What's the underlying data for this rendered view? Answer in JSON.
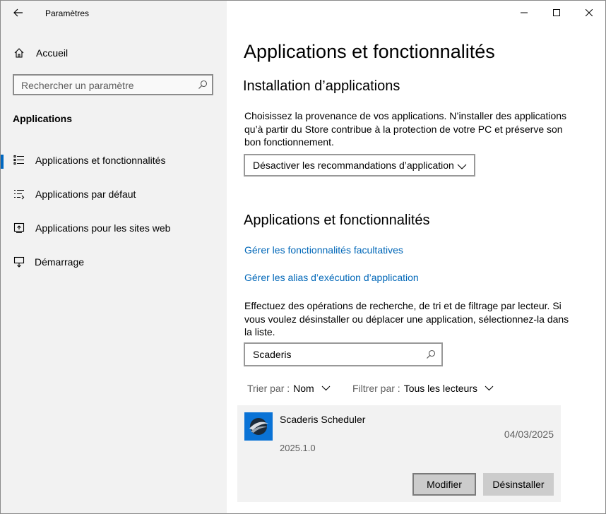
{
  "window": {
    "title": "Paramètres",
    "controls": [
      "minimize",
      "maximize",
      "close"
    ]
  },
  "sidebar": {
    "home_label": "Accueil",
    "search_placeholder": "Rechercher un paramètre",
    "section_title": "Applications",
    "items": [
      {
        "label": "Applications et fonctionnalités",
        "icon": "apps-features-icon",
        "selected": true
      },
      {
        "label": "Applications par défaut",
        "icon": "default-apps-icon",
        "selected": false
      },
      {
        "label": "Applications pour les sites web",
        "icon": "apps-for-websites-icon",
        "selected": false
      },
      {
        "label": "Démarrage",
        "icon": "startup-icon",
        "selected": false
      }
    ],
    "accent_color": "#0067c0"
  },
  "main": {
    "page_title": "Applications et fonctionnalités",
    "install_section": {
      "heading": "Installation d’applications",
      "description": "Choisissez la provenance de vos applications. N’installer des applications qu’à partir du Store contribue à la protection de votre PC et préserve son bon fonctionnement.",
      "dropdown_value": "Désactiver les recommandations d’application"
    },
    "apps_section": {
      "heading": "Applications et fonctionnalités",
      "link_optional_features": "Gérer les fonctionnalités facultatives",
      "link_alias": "Gérer les alias d’exécution d’application",
      "description": "Effectuez des opérations de recherche, de tri et de filtrage par lecteur. Si vous voulez désinstaller ou déplacer une application, sélectionnez-la dans la liste.",
      "search_value": "Scaderis",
      "sort_label": "Trier par :",
      "sort_value": "Nom",
      "filter_label": "Filtrer par :",
      "filter_value": "Tous les lecteurs",
      "app": {
        "name": "Scaderis Scheduler",
        "version": "2025.1.0",
        "date": "04/03/2025",
        "modify_label": "Modifier",
        "uninstall_label": "Désinstaller"
      }
    },
    "link_color": "#0067b8"
  }
}
